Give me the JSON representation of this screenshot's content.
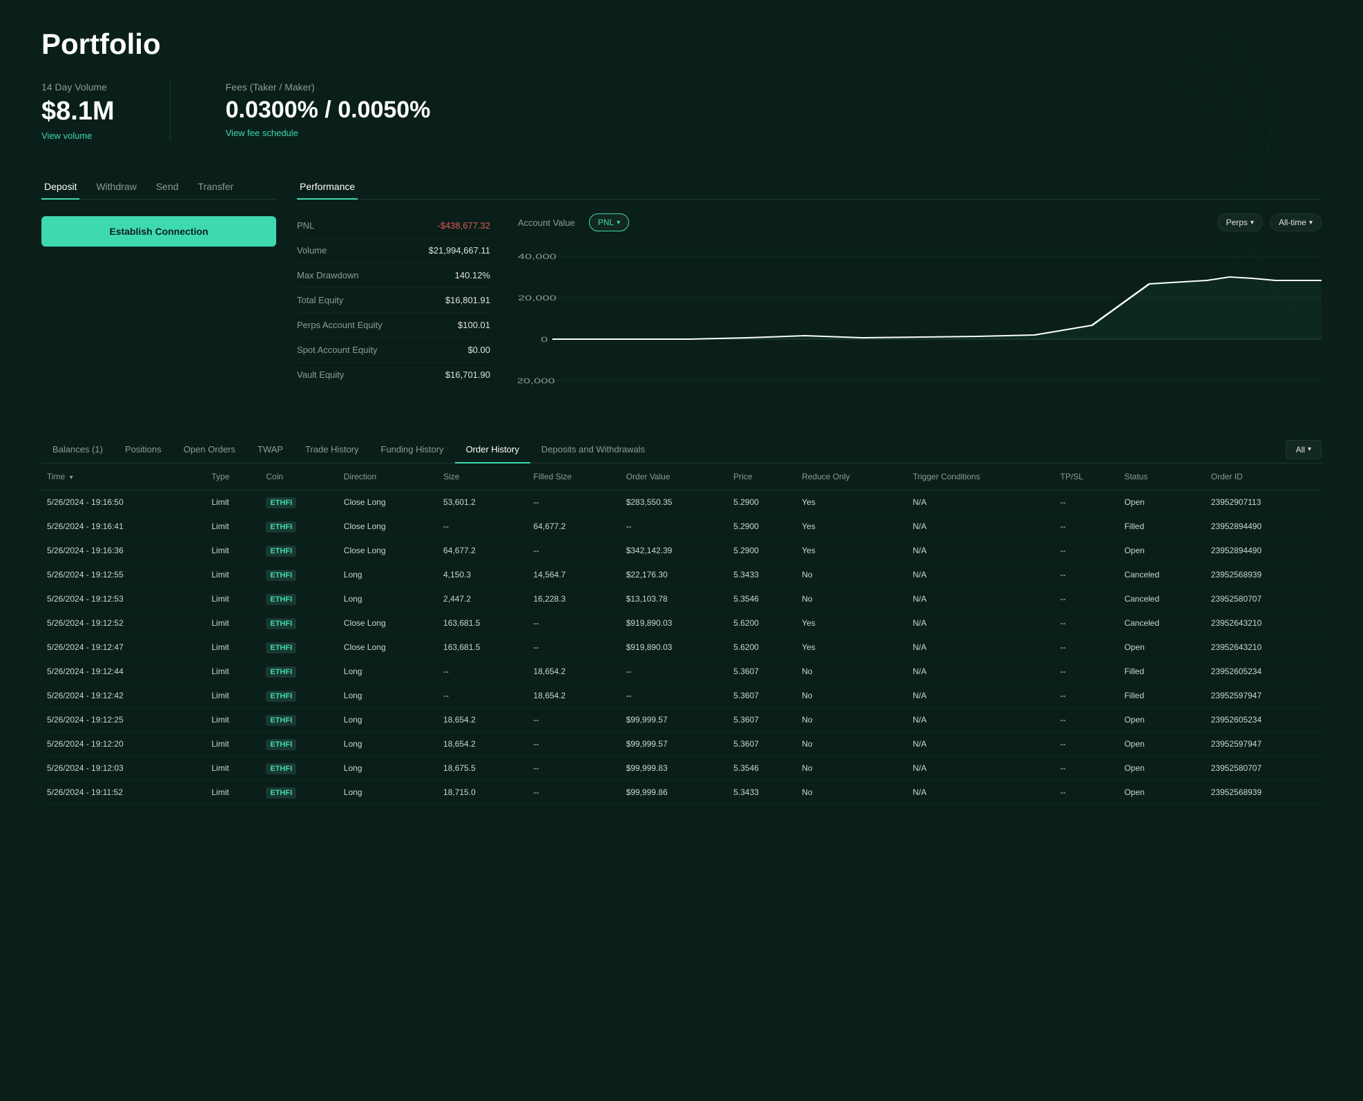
{
  "page": {
    "title": "Portfolio"
  },
  "stats": {
    "volume_label": "14 Day Volume",
    "volume_value": "$8.1M",
    "volume_link": "View volume",
    "fees_label": "Fees (Taker / Maker)",
    "fees_value": "0.0300% / 0.0050%",
    "fees_link": "View fee schedule"
  },
  "left_panel": {
    "tabs": [
      "Deposit",
      "Withdraw",
      "Send",
      "Transfer"
    ],
    "active_tab": "Deposit",
    "establish_btn": "Establish Connection"
  },
  "performance": {
    "tab_label": "Performance",
    "metrics": [
      {
        "key": "PNL",
        "value": "-$438,677.32",
        "negative": true
      },
      {
        "key": "Volume",
        "value": "$21,994,667.11",
        "negative": false
      },
      {
        "key": "Max Drawdown",
        "value": "140.12%",
        "negative": false
      },
      {
        "key": "Total Equity",
        "value": "$16,801.91",
        "negative": false
      },
      {
        "key": "Perps Account Equity",
        "value": "$100.01",
        "negative": false
      },
      {
        "key": "Spot Account Equity",
        "value": "$0.00",
        "negative": false
      },
      {
        "key": "Vault Equity",
        "value": "$16,701.90",
        "negative": false
      }
    ],
    "chart": {
      "account_value_label": "Account Value",
      "pnl_label": "PNL",
      "perps_label": "Perps",
      "alltime_label": "All-time",
      "y_labels": [
        "40,000",
        "20,000",
        "0",
        "-20,000"
      ],
      "y_values": [
        40000,
        20000,
        0,
        -20000
      ]
    }
  },
  "bottom_tabs": [
    {
      "label": "Balances (1)",
      "active": false
    },
    {
      "label": "Positions",
      "active": false
    },
    {
      "label": "Open Orders",
      "active": false
    },
    {
      "label": "TWAP",
      "active": false
    },
    {
      "label": "Trade History",
      "active": false
    },
    {
      "label": "Funding History",
      "active": false
    },
    {
      "label": "Order History",
      "active": true
    },
    {
      "label": "Deposits and Withdrawals",
      "active": false
    }
  ],
  "filter": {
    "label": "All",
    "icon": "chevron-down"
  },
  "table": {
    "columns": [
      "Time",
      "Type",
      "Coin",
      "Direction",
      "Size",
      "Filled Size",
      "Order Value",
      "Price",
      "Reduce Only",
      "Trigger Conditions",
      "TP/SL",
      "Status",
      "Order ID"
    ],
    "rows": [
      {
        "time": "5/26/2024 - 19:16:50",
        "type": "Limit",
        "coin": "ETHFI",
        "direction": "Close Long",
        "direction_type": "close_long",
        "size": "53,601.2",
        "filled_size": "--",
        "order_value": "$283,550.35",
        "price": "5.2900",
        "reduce_only": "Yes",
        "trigger": "N/A",
        "tp_sl": "--",
        "status": "Open",
        "order_id": "23952907113"
      },
      {
        "time": "5/26/2024 - 19:16:41",
        "type": "Limit",
        "coin": "ETHFI",
        "direction": "Close Long",
        "direction_type": "close_long",
        "size": "--",
        "filled_size": "64,677.2",
        "order_value": "--",
        "price": "5.2900",
        "reduce_only": "Yes",
        "trigger": "N/A",
        "tp_sl": "--",
        "status": "Filled",
        "order_id": "23952894490"
      },
      {
        "time": "5/26/2024 - 19:16:36",
        "type": "Limit",
        "coin": "ETHFI",
        "direction": "Close Long",
        "direction_type": "close_long",
        "size": "64,677.2",
        "filled_size": "--",
        "order_value": "$342,142.39",
        "price": "5.2900",
        "reduce_only": "Yes",
        "trigger": "N/A",
        "tp_sl": "--",
        "status": "Open",
        "order_id": "23952894490"
      },
      {
        "time": "5/26/2024 - 19:12:55",
        "type": "Limit",
        "coin": "ETHFI",
        "direction": "Long",
        "direction_type": "long",
        "size": "4,150.3",
        "filled_size": "14,564.7",
        "order_value": "$22,176.30",
        "price": "5.3433",
        "reduce_only": "No",
        "trigger": "N/A",
        "tp_sl": "--",
        "status": "Canceled",
        "order_id": "23952568939"
      },
      {
        "time": "5/26/2024 - 19:12:53",
        "type": "Limit",
        "coin": "ETHFI",
        "direction": "Long",
        "direction_type": "long",
        "size": "2,447.2",
        "filled_size": "16,228.3",
        "order_value": "$13,103.78",
        "price": "5.3546",
        "reduce_only": "No",
        "trigger": "N/A",
        "tp_sl": "--",
        "status": "Canceled",
        "order_id": "23952580707"
      },
      {
        "time": "5/26/2024 - 19:12:52",
        "type": "Limit",
        "coin": "ETHFI",
        "direction": "Close Long",
        "direction_type": "close_long",
        "size": "163,681.5",
        "filled_size": "--",
        "order_value": "$919,890.03",
        "price": "5.6200",
        "reduce_only": "Yes",
        "trigger": "N/A",
        "tp_sl": "--",
        "status": "Canceled",
        "order_id": "23952643210"
      },
      {
        "time": "5/26/2024 - 19:12:47",
        "type": "Limit",
        "coin": "ETHFI",
        "direction": "Close Long",
        "direction_type": "close_long",
        "size": "163,681.5",
        "filled_size": "--",
        "order_value": "$919,890.03",
        "price": "5.6200",
        "reduce_only": "Yes",
        "trigger": "N/A",
        "tp_sl": "--",
        "status": "Open",
        "order_id": "23952643210"
      },
      {
        "time": "5/26/2024 - 19:12:44",
        "type": "Limit",
        "coin": "ETHFI",
        "direction": "Long",
        "direction_type": "long",
        "size": "--",
        "filled_size": "18,654.2",
        "order_value": "--",
        "price": "5.3607",
        "reduce_only": "No",
        "trigger": "N/A",
        "tp_sl": "--",
        "status": "Filled",
        "order_id": "23952605234"
      },
      {
        "time": "5/26/2024 - 19:12:42",
        "type": "Limit",
        "coin": "ETHFI",
        "direction": "Long",
        "direction_type": "long",
        "size": "--",
        "filled_size": "18,654.2",
        "order_value": "--",
        "price": "5.3607",
        "reduce_only": "No",
        "trigger": "N/A",
        "tp_sl": "--",
        "status": "Filled",
        "order_id": "23952597947"
      },
      {
        "time": "5/26/2024 - 19:12:25",
        "type": "Limit",
        "coin": "ETHFI",
        "direction": "Long",
        "direction_type": "long",
        "size": "18,654.2",
        "filled_size": "--",
        "order_value": "$99,999.57",
        "price": "5.3607",
        "reduce_only": "No",
        "trigger": "N/A",
        "tp_sl": "--",
        "status": "Open",
        "order_id": "23952605234"
      },
      {
        "time": "5/26/2024 - 19:12:20",
        "type": "Limit",
        "coin": "ETHFI",
        "direction": "Long",
        "direction_type": "long",
        "size": "18,654.2",
        "filled_size": "--",
        "order_value": "$99,999.57",
        "price": "5.3607",
        "reduce_only": "No",
        "trigger": "N/A",
        "tp_sl": "--",
        "status": "Open",
        "order_id": "23952597947"
      },
      {
        "time": "5/26/2024 - 19:12:03",
        "type": "Limit",
        "coin": "ETHFI",
        "direction": "Long",
        "direction_type": "long",
        "size": "18,675.5",
        "filled_size": "--",
        "order_value": "$99,999.83",
        "price": "5.3546",
        "reduce_only": "No",
        "trigger": "N/A",
        "tp_sl": "--",
        "status": "Open",
        "order_id": "23952580707"
      },
      {
        "time": "5/26/2024 - 19:11:52",
        "type": "Limit",
        "coin": "ETHFI",
        "direction": "Long",
        "direction_type": "long",
        "size": "18,715.0",
        "filled_size": "--",
        "order_value": "$99,999.86",
        "price": "5.3433",
        "reduce_only": "No",
        "trigger": "N/A",
        "tp_sl": "--",
        "status": "Open",
        "order_id": "23952568939"
      }
    ]
  }
}
